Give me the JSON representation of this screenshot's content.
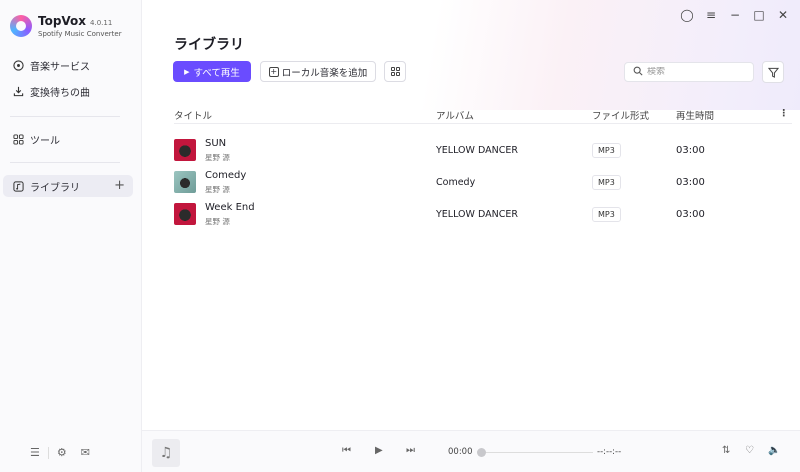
{
  "app": {
    "name": "TopVox",
    "version": "4.0.11",
    "subtitle": "Spotify Music Converter"
  },
  "sidebar": {
    "items": [
      {
        "label": "音楽サービス",
        "icon": "music-service-icon"
      },
      {
        "label": "変換待ちの曲",
        "icon": "download-icon"
      },
      {
        "label": "ツール",
        "icon": "tools-grid-icon"
      },
      {
        "label": "ライブラリ",
        "icon": "library-icon",
        "active": true
      }
    ],
    "add_label": "+"
  },
  "page": {
    "title": "ライブラリ"
  },
  "toolbar": {
    "play_all_label": "すべて再生",
    "add_local_label": "ローカル音楽を追加",
    "search_placeholder": "検索"
  },
  "table": {
    "headers": {
      "title": "タイトル",
      "album": "アルバム",
      "format": "ファイル形式",
      "duration": "再生時間"
    },
    "rows": [
      {
        "title": "SUN",
        "artist": "星野 源",
        "album": "YELLOW DANCER",
        "format": "MP3",
        "duration": "03:00",
        "cover": "red"
      },
      {
        "title": "Comedy",
        "artist": "星野 源",
        "album": "Comedy",
        "format": "MP3",
        "duration": "03:00",
        "cover": "teal"
      },
      {
        "title": "Week End",
        "artist": "星野 源",
        "album": "YELLOW DANCER",
        "format": "MP3",
        "duration": "03:00",
        "cover": "red"
      }
    ]
  },
  "player": {
    "current_time": "00:00",
    "total_time": "--:--:--",
    "progress": 0
  },
  "colors": {
    "accent": "#6a4cff",
    "cover_red": "#c2163d",
    "cover_teal": "#8fb9b4"
  }
}
